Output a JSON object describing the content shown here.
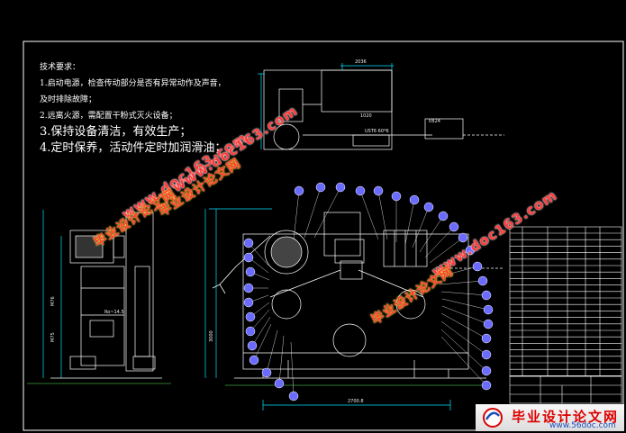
{
  "technical_requirements": {
    "heading": "技术要求：",
    "line_1": "1.启动电源，检查传动部分是否有异常动作及声音，",
    "line_1b": "及时排除故障；",
    "line_2": "2.远离火源，需配置干粉式灭火设备；",
    "line_3": "3.保持设备清洁，有效生产；",
    "line_4": "4.定时保养，活动件定时加润滑油；"
  },
  "watermarks": {
    "url": "www.doc163.com",
    "cn": "毕业设计论文网"
  },
  "logo": {
    "cn": "毕业设计论文网",
    "url": "www.56doc.com"
  },
  "colors": {
    "background": "#000000",
    "line_white": "#ffffff",
    "line_cyan": "#00e5ff",
    "balloon_blue": "#6b6bff",
    "hatch_green": "#40a040",
    "watermark_red": "#ff3b3b"
  }
}
